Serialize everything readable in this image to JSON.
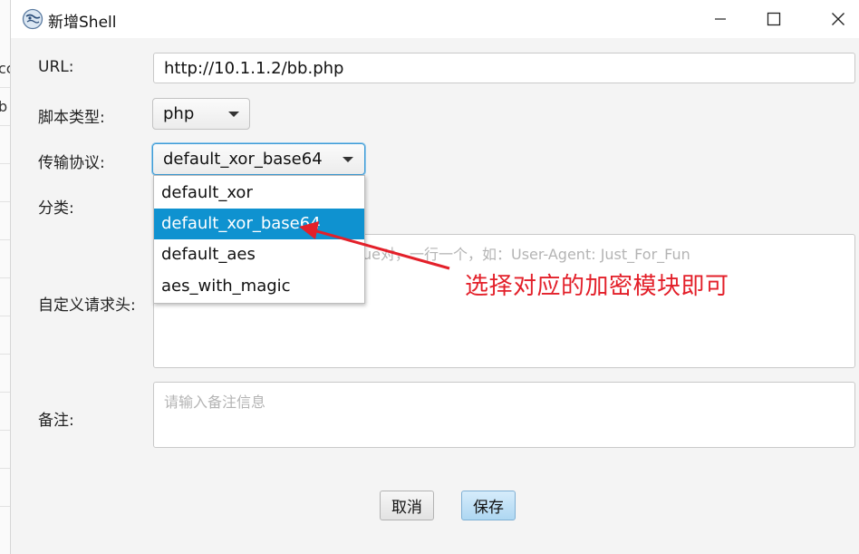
{
  "window": {
    "title": "新增Shell"
  },
  "background": {
    "fragment_1": "cc",
    "fragment_2": "b"
  },
  "form": {
    "url": {
      "label": "URL:",
      "value": "http://10.1.1.2/bb.php"
    },
    "script_type": {
      "label": "脚本类型:",
      "value": "php"
    },
    "protocol": {
      "label": "传输协议:",
      "value": "default_xor_base64",
      "options": [
        "default_xor",
        "default_xor_base64",
        "default_aes",
        "aes_with_magic"
      ],
      "highlighted_index": 1
    },
    "category": {
      "label": "分类:"
    },
    "custom_headers": {
      "label": "自定义请求头:",
      "placeholder_visible": "ue对，一行一个，如：User-Agent: Just_For_Fun"
    },
    "remark": {
      "label": "备注:",
      "placeholder": "请输入备注信息"
    }
  },
  "buttons": {
    "cancel": "取消",
    "save": "保存"
  },
  "annotation": {
    "text": "选择对应的加密模块即可",
    "color": "#e3202a"
  },
  "colors": {
    "selection": "#0f92d0",
    "focus_border": "#3c9bd6"
  }
}
